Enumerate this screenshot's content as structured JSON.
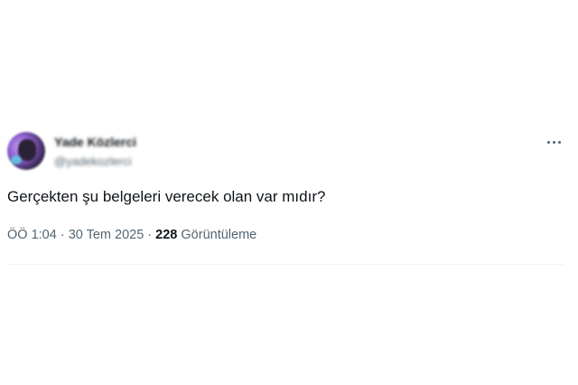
{
  "author": {
    "display_name": "Yade Közlerci",
    "handle": "@yadekozlerci",
    "avatar_icon": "user-avatar"
  },
  "tweet": {
    "text": "Gerçekten şu belgeleri verecek olan var mıdır?",
    "time": "ÖÖ 1:04",
    "separator": " · ",
    "date": "30 Tem 2025",
    "views_count": "228",
    "views_label": "Görüntüleme"
  },
  "actions": {
    "more_icon": "more-horizontal-icon"
  },
  "colors": {
    "text_primary": "#0f1419",
    "text_secondary": "#536471",
    "divider": "#eff3f4"
  }
}
